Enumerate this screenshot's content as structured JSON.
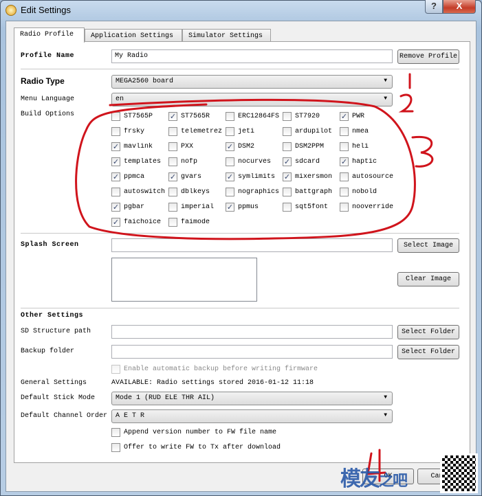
{
  "window": {
    "title": "Edit Settings",
    "help_label": "?",
    "close_label": "X"
  },
  "tabs": [
    {
      "label": "Radio Profile",
      "active": true
    },
    {
      "label": "Application Settings"
    },
    {
      "label": "Simulator Settings"
    }
  ],
  "profile": {
    "name_label": "Profile Name",
    "name_value": "My Radio",
    "remove_button": "Remove Profile"
  },
  "radio_type": {
    "label": "Radio Type",
    "value": "MEGA2560 board"
  },
  "menu_language": {
    "label": "Menu Language",
    "value": "en"
  },
  "build_options": {
    "label": "Build Options",
    "options": [
      {
        "label": "ST7565P",
        "checked": false
      },
      {
        "label": "ST7565R",
        "checked": true
      },
      {
        "label": "ERC12864FS",
        "checked": false
      },
      {
        "label": "ST7920",
        "checked": false
      },
      {
        "label": "PWR",
        "checked": true
      },
      {
        "label": "frsky",
        "checked": false
      },
      {
        "label": "telemetrez",
        "checked": false
      },
      {
        "label": "jeti",
        "checked": false
      },
      {
        "label": "ardupilot",
        "checked": false
      },
      {
        "label": "nmea",
        "checked": false
      },
      {
        "label": "mavlink",
        "checked": true
      },
      {
        "label": "PXX",
        "checked": false
      },
      {
        "label": "DSM2",
        "checked": true
      },
      {
        "label": "DSM2PPM",
        "checked": false
      },
      {
        "label": "heli",
        "checked": false
      },
      {
        "label": "templates",
        "checked": true
      },
      {
        "label": "nofp",
        "checked": false
      },
      {
        "label": "nocurves",
        "checked": false
      },
      {
        "label": "sdcard",
        "checked": true
      },
      {
        "label": "haptic",
        "checked": true
      },
      {
        "label": "ppmca",
        "checked": true
      },
      {
        "label": "gvars",
        "checked": true
      },
      {
        "label": "symlimits",
        "checked": true
      },
      {
        "label": "mixersmon",
        "checked": true
      },
      {
        "label": "autosource",
        "checked": false
      },
      {
        "label": "autoswitch",
        "checked": false
      },
      {
        "label": "dblkeys",
        "checked": false
      },
      {
        "label": "nographics",
        "checked": false
      },
      {
        "label": "battgraph",
        "checked": false
      },
      {
        "label": "nobold",
        "checked": false
      },
      {
        "label": "pgbar",
        "checked": true
      },
      {
        "label": "imperial",
        "checked": false
      },
      {
        "label": "ppmus",
        "checked": true
      },
      {
        "label": "sqt5font",
        "checked": false
      },
      {
        "label": "nooverride",
        "checked": false
      },
      {
        "label": "faichoice",
        "checked": true
      },
      {
        "label": "faimode",
        "checked": false
      }
    ]
  },
  "splash": {
    "label": "Splash Screen",
    "path_value": "",
    "select_button": "Select Image",
    "clear_button": "Clear Image"
  },
  "other": {
    "heading": "Other Settings",
    "sd_label": "SD Structure path",
    "sd_value": "",
    "sd_button": "Select Folder",
    "backup_label": "Backup folder",
    "backup_value": "",
    "backup_button": "Select Folder",
    "auto_backup_label": "Enable automatic backup before writing firmware",
    "auto_backup_checked": false,
    "general_label": "General Settings",
    "general_value": "AVAILABLE: Radio settings stored 2016-01-12 11:18",
    "stick_label": "Default Stick Mode",
    "stick_value": "Mode 1 (RUD ELE THR AIL)",
    "channel_label": "Default Channel Order",
    "channel_value": "A E T R",
    "append_label": "Append version number to FW file name",
    "append_checked": false,
    "offer_label": "Offer to write FW to Tx after download",
    "offer_checked": false
  },
  "footer": {
    "ok_button": "OK",
    "cancel_button": "Cancel"
  },
  "annotations": [
    "1",
    "2",
    "3",
    "4"
  ],
  "watermark": {
    "text": "模友之吧",
    "url": "http://www.moz8.com"
  },
  "colors": {
    "annotation": "#d0141c",
    "close": "#c43c28"
  }
}
